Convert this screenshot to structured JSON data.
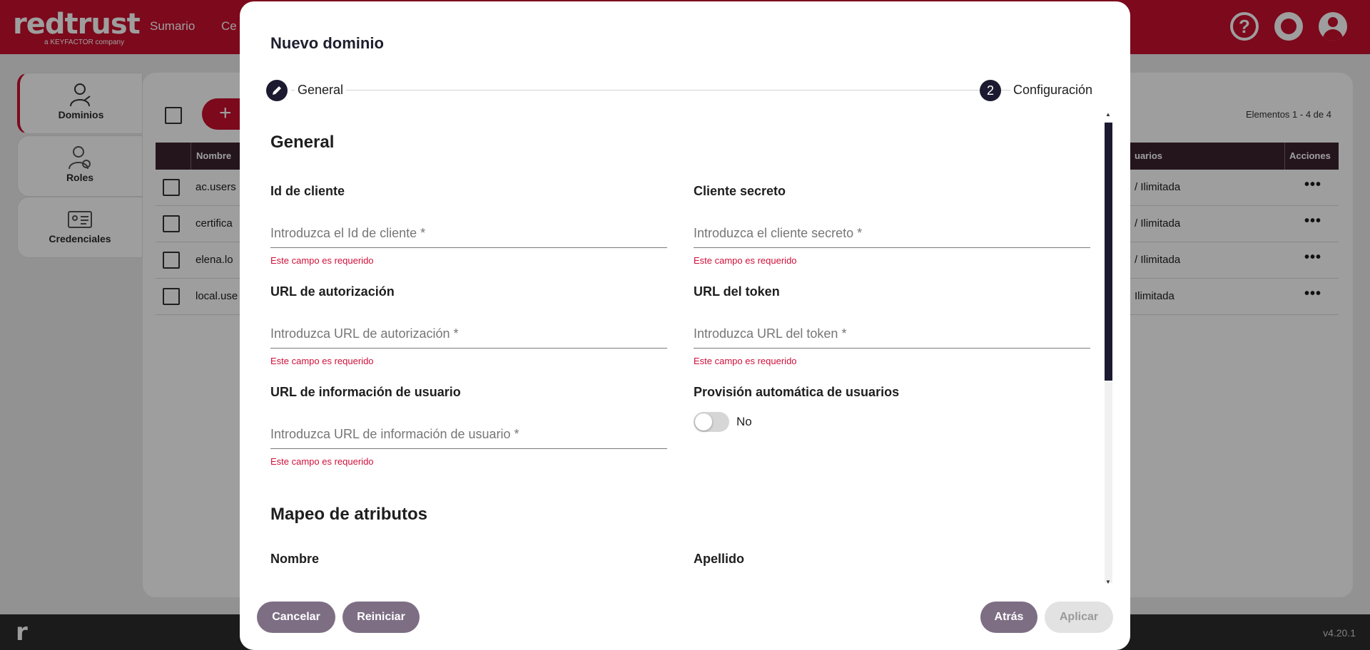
{
  "app": {
    "logo_main": "redtrust",
    "logo_sub": "a KEYFACTOR company",
    "nav": [
      "Sumario",
      "Ce"
    ],
    "footer_logo": "r",
    "version": "v4.20.1"
  },
  "sidebar": {
    "items": [
      {
        "label": "Dominios",
        "icon": "user-link-icon",
        "active": true
      },
      {
        "label": "Roles",
        "icon": "user-gear-icon",
        "active": false
      },
      {
        "label": "Credenciales",
        "icon": "id-card-icon",
        "active": false
      }
    ]
  },
  "list": {
    "add_symbol": "+",
    "count": "Elementos 1 - 4 de 4",
    "columns": {
      "name": "Nombre",
      "users": "uarios",
      "actions": "Acciones"
    },
    "rows": [
      {
        "name": "ac.users",
        "users": "/ Ilimitada"
      },
      {
        "name": "certifica",
        "users": "/ Ilimitada"
      },
      {
        "name": "elena.lo",
        "users": "/ Ilimitada"
      },
      {
        "name": "local.use",
        "users": "Ilimitada"
      }
    ],
    "row_menu": "•••"
  },
  "modal": {
    "title": "Nuevo dominio",
    "steps": [
      {
        "number": "",
        "label": "General",
        "icon": "pencil-icon"
      },
      {
        "number": "2",
        "label": "Configuración"
      }
    ],
    "section_general": "General",
    "fields": {
      "client_id": {
        "label": "Id de cliente",
        "placeholder": "Introduzca el Id de cliente *",
        "value": "",
        "error": "Este campo es requerido"
      },
      "client_secret": {
        "label": "Cliente secreto",
        "placeholder": "Introduzca el cliente secreto *",
        "value": "",
        "error": "Este campo es requerido"
      },
      "auth_url": {
        "label": "URL de autorización",
        "placeholder": "Introduzca URL de autorización *",
        "value": "",
        "error": "Este campo es requerido"
      },
      "token_url": {
        "label": "URL del token",
        "placeholder": "Introduzca URL del token *",
        "value": "",
        "error": "Este campo es requerido"
      },
      "userinfo_url": {
        "label": "URL de información de usuario",
        "placeholder": "Introduzca URL de información de usuario *",
        "value": "",
        "error": "Este campo es requerido"
      }
    },
    "auto_provision": {
      "label": "Provisión automática de usuarios",
      "state": "No"
    },
    "section_mapping": "Mapeo de atributos",
    "mapping_fields": {
      "first_name": "Nombre",
      "last_name": "Apellido"
    },
    "buttons": {
      "cancel": "Cancelar",
      "reset": "Reiniciar",
      "back": "Atrás",
      "apply": "Aplicar"
    }
  }
}
